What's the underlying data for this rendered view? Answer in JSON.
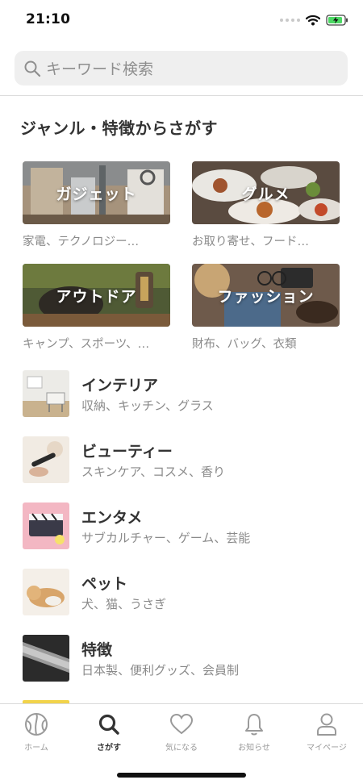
{
  "status_bar": {
    "time": "21:10",
    "icons": [
      "signal-dots-icon",
      "wifi-icon",
      "battery-charging-icon"
    ],
    "battery_color": "#4cd964"
  },
  "search": {
    "placeholder": "キーワード検索",
    "icon": "search-icon"
  },
  "section_title": "ジャンル・特徴からさがす",
  "genres": [
    {
      "label": "ガジェット",
      "sub": "家電、テクノロジー…"
    },
    {
      "label": "グルメ",
      "sub": "お取り寄せ、フード…"
    },
    {
      "label": "アウトドア",
      "sub": "キャンプ、スポーツ、…"
    },
    {
      "label": "ファッション",
      "sub": "財布、バッグ、衣類"
    }
  ],
  "list": [
    {
      "title": "インテリア",
      "sub": "収納、キッチン、グラス"
    },
    {
      "title": "ビューティー",
      "sub": "スキンケア、コスメ、香り"
    },
    {
      "title": "エンタメ",
      "sub": "サブカルチャー、ゲーム、芸能"
    },
    {
      "title": "ペット",
      "sub": "犬、猫、うさぎ"
    },
    {
      "title": "特徴",
      "sub": "日本製、便利グッズ、会員制"
    }
  ],
  "tabs": [
    {
      "label": "ホーム",
      "icon": "home-globe-icon",
      "active": false
    },
    {
      "label": "さがす",
      "icon": "search-icon",
      "active": true
    },
    {
      "label": "気になる",
      "icon": "heart-icon",
      "active": false
    },
    {
      "label": "お知らせ",
      "icon": "bell-icon",
      "active": false
    },
    {
      "label": "マイページ",
      "icon": "person-icon",
      "active": false
    }
  ],
  "colors": {
    "accent": "#333333",
    "inactive": "#9a9a9a",
    "list_peek": "#f2d34a"
  }
}
